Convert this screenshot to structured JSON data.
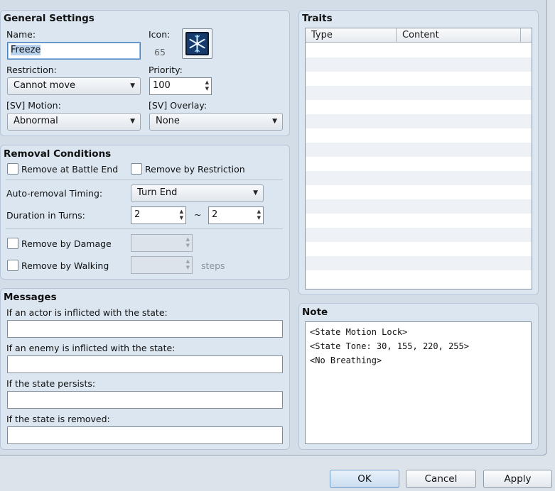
{
  "general": {
    "title": "General Settings",
    "name_label": "Name:",
    "name_value": "Freeze",
    "icon_label": "Icon:",
    "icon_index": "65",
    "icon_name": "snowflake-icon",
    "restriction_label": "Restriction:",
    "restriction_value": "Cannot move",
    "priority_label": "Priority:",
    "priority_value": "100",
    "motion_label": "[SV] Motion:",
    "motion_value": "Abnormal",
    "overlay_label": "[SV] Overlay:",
    "overlay_value": "None"
  },
  "removal": {
    "title": "Removal Conditions",
    "battle_end_label": "Remove at Battle End",
    "restriction_label": "Remove by Restriction",
    "timing_label": "Auto-removal Timing:",
    "timing_value": "Turn End",
    "duration_label": "Duration in Turns:",
    "duration_min": "2",
    "duration_sep": "~",
    "duration_max": "2",
    "damage_label": "Remove by Damage",
    "walking_label": "Remove by Walking",
    "steps_label": "steps"
  },
  "messages": {
    "title": "Messages",
    "actor_label": "If an actor is inflicted with the state:",
    "actor_value": "",
    "enemy_label": "If an enemy is inflicted with the state:",
    "enemy_value": "",
    "persist_label": "If the state persists:",
    "persist_value": "",
    "removed_label": "If the state is removed:",
    "removed_value": ""
  },
  "traits": {
    "title": "Traits",
    "columns": [
      "Type",
      "Content"
    ]
  },
  "note": {
    "title": "Note",
    "lines": [
      "<State Motion Lock>",
      "<State Tone: 30, 155, 220, 255>",
      "<No Breathing>"
    ]
  },
  "buttons": {
    "ok": "OK",
    "cancel": "Cancel",
    "apply": "Apply"
  },
  "colors": {
    "panel_bg": "#dbe6f1",
    "window_bg": "#dde3eb",
    "accent": "#4a86c5"
  }
}
